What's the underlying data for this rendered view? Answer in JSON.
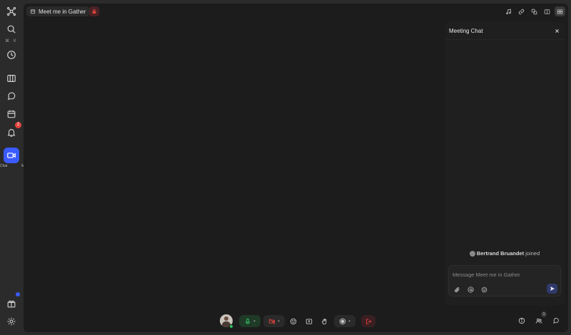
{
  "rail": {
    "search_shortcut": "⌘ K",
    "notifications_badge": "2",
    "active_caption_left": "Char",
    "active_caption_right": "Mee"
  },
  "topbar": {
    "meeting_title": "Meet me in Gather"
  },
  "chat": {
    "title": "Meeting Chat",
    "join_name": "Bertrand Bruandet",
    "join_suffix": "joined",
    "composer_placeholder": "Message Meet me in Gather"
  },
  "controls": {
    "participants_count": "1"
  },
  "colors": {
    "accent": "#3b5bff",
    "danger": "#e2453c",
    "mic_on": "#3fc46b"
  }
}
